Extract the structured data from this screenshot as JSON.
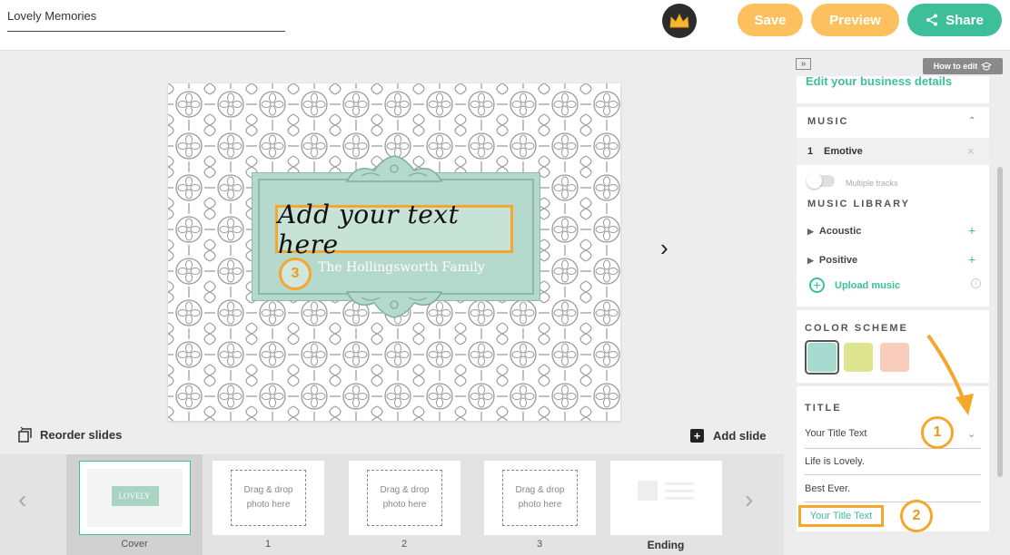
{
  "header": {
    "project_name": "Lovely Memories",
    "save_label": "Save",
    "preview_label": "Preview",
    "share_label": "Share"
  },
  "slide": {
    "title_text": "Add your text here",
    "subtitle_text": "The Hollingsworth Family",
    "badge_3": "3"
  },
  "stage": {
    "reorder_label": "Reorder slides",
    "add_slide_label": "Add slide"
  },
  "filmstrip": {
    "cover_label": "Cover",
    "cover_thumb_text": "LOVELY",
    "drop_text": "Drag & drop photo here",
    "slides": [
      {
        "label": "1"
      },
      {
        "label": "2"
      },
      {
        "label": "3"
      }
    ],
    "ending_label": "Ending"
  },
  "panel": {
    "how_to_edit": "How to edit",
    "edit_business": "Edit your business details",
    "music_title": "MUSIC",
    "track_number": "1",
    "track_name": "Emotive",
    "multiple_tracks": "Multiple tracks",
    "library_title": "MUSIC LIBRARY",
    "library_items": [
      "Acoustic",
      "Positive"
    ],
    "upload_music": "Upload music",
    "color_scheme_title": "COLOR SCHEME",
    "swatch_colors": [
      "#a8dbcf",
      "#dde68e",
      "#f8cdbb"
    ],
    "title_section": "TITLE",
    "title_selected": "Your Title Text",
    "title_options": [
      "Life is Lovely.",
      "Best Ever.",
      "Your Title Text"
    ],
    "badge_1": "1",
    "badge_2": "2"
  },
  "colors": {
    "accent_green": "#3dbf99",
    "accent_yellow": "#fcc15e",
    "highlight_orange": "#f4a72a"
  }
}
